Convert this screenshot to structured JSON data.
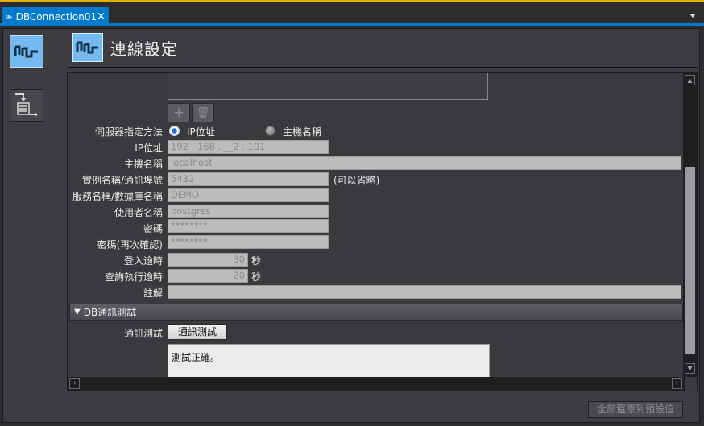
{
  "tab": {
    "title": "DBConnection01",
    "close": "×"
  },
  "header": {
    "title": "連線設定"
  },
  "toolbar": {
    "add": "+",
    "delete": "🗑"
  },
  "server_method": {
    "label": "伺服器指定方法",
    "options": [
      {
        "label": "IP位址",
        "selected": true
      },
      {
        "label": "主機名稱",
        "selected": false
      }
    ]
  },
  "form": {
    "ip": {
      "label": "IP位址",
      "value": "192 . 168 . __2 . 101"
    },
    "hostname": {
      "label": "主機名稱",
      "value": "localhost"
    },
    "instance": {
      "label": "實例名稱/通訊埠號",
      "value": "5432",
      "note": "(可以省略)"
    },
    "service": {
      "label": "服務名稱/數據庫名稱",
      "value": "DEMO"
    },
    "user": {
      "label": "使用者名稱",
      "value": "postgres"
    },
    "password": {
      "label": "密碼",
      "value": "********"
    },
    "password_confirm": {
      "label": "密碼(再次確認)",
      "value": "********"
    },
    "login_timeout": {
      "label": "登入逾時",
      "value": "30",
      "unit": "秒"
    },
    "query_timeout": {
      "label": "查詢執行逾時",
      "value": "20",
      "unit": "秒"
    },
    "comment": {
      "label": "註解",
      "value": ""
    }
  },
  "db_test": {
    "section_title": "DB通訊測試",
    "label": "通訊測試",
    "button": "通訊測試",
    "result": "測試正確。"
  },
  "footer": {
    "reset_button": "全部還原到預設值"
  },
  "colors": {
    "accent": "#007acc",
    "icon_bg": "#74b9ef",
    "top_bar": "#e0b400"
  }
}
